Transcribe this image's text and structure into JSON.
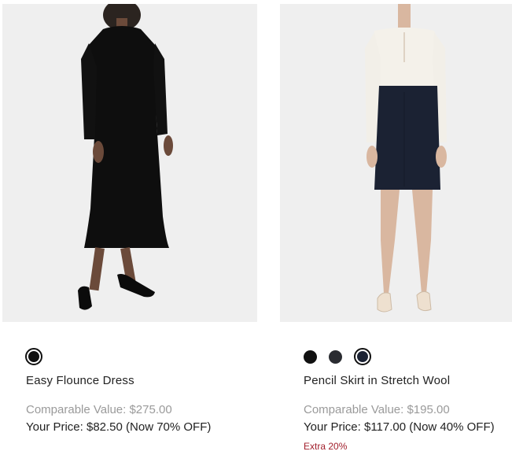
{
  "products": [
    {
      "name": "Easy Flounce Dress",
      "image_alt": "woman wearing black long-sleeve midi dress",
      "swatches": [
        {
          "color": "#111111",
          "selected": true
        }
      ],
      "comparable": "Comparable Value: $275.00",
      "your_price": "Your Price: $82.50 (Now 70% OFF)",
      "extra": ""
    },
    {
      "name": "Pencil Skirt in Stretch Wool",
      "image_alt": "woman wearing navy pencil skirt and ivory blouse",
      "swatches": [
        {
          "color": "#111111",
          "selected": false
        },
        {
          "color": "#2a2c31",
          "selected": false
        },
        {
          "color": "#1b2233",
          "selected": true
        }
      ],
      "comparable": "Comparable Value: $195.00",
      "your_price": "Your Price: $117.00 (Now 40% OFF)",
      "extra": "Extra 20%"
    }
  ],
  "colors": {
    "image_bg": "#efefef",
    "sale_red": "#a11e2b",
    "muted_text": "#9a9a9a"
  }
}
